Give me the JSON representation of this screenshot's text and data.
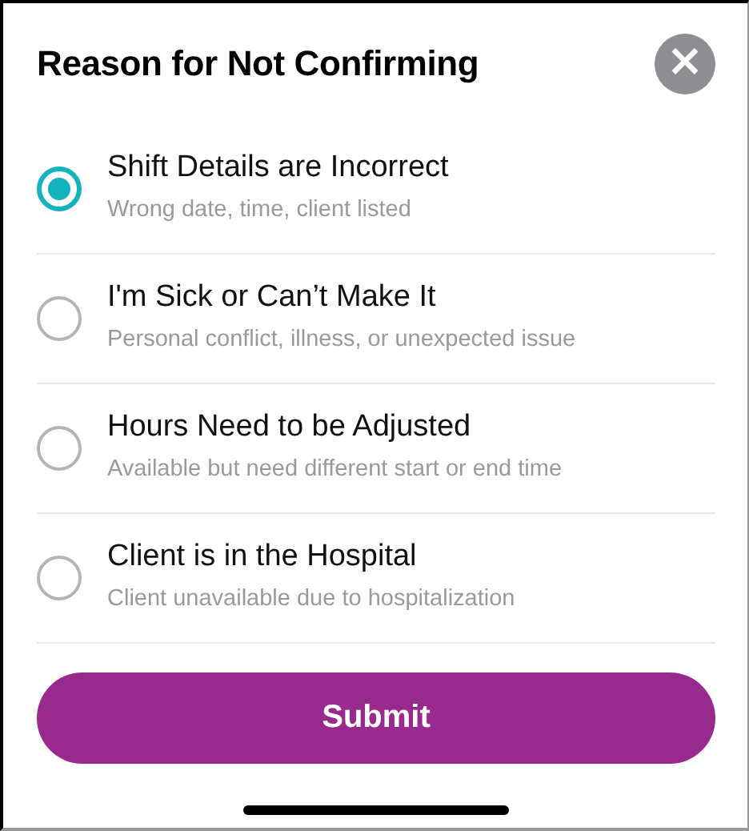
{
  "title": "Reason for Not Confirming",
  "close_button": {
    "label": "×"
  },
  "options": [
    {
      "title": "Shift Details are Incorrect",
      "subtitle": "Wrong date, time, client listed",
      "selected": true
    },
    {
      "title": "I'm Sick or Can’t Make It",
      "subtitle": "Personal conflict, illness, or unexpected issue",
      "selected": false
    },
    {
      "title": "Hours Need to be Adjusted",
      "subtitle": "Available but need different start or end time",
      "selected": false
    },
    {
      "title": "Client is in the Hospital",
      "subtitle": "Client unavailable due to hospitalization",
      "selected": false
    }
  ],
  "submit_button": {
    "label": "Submit"
  }
}
